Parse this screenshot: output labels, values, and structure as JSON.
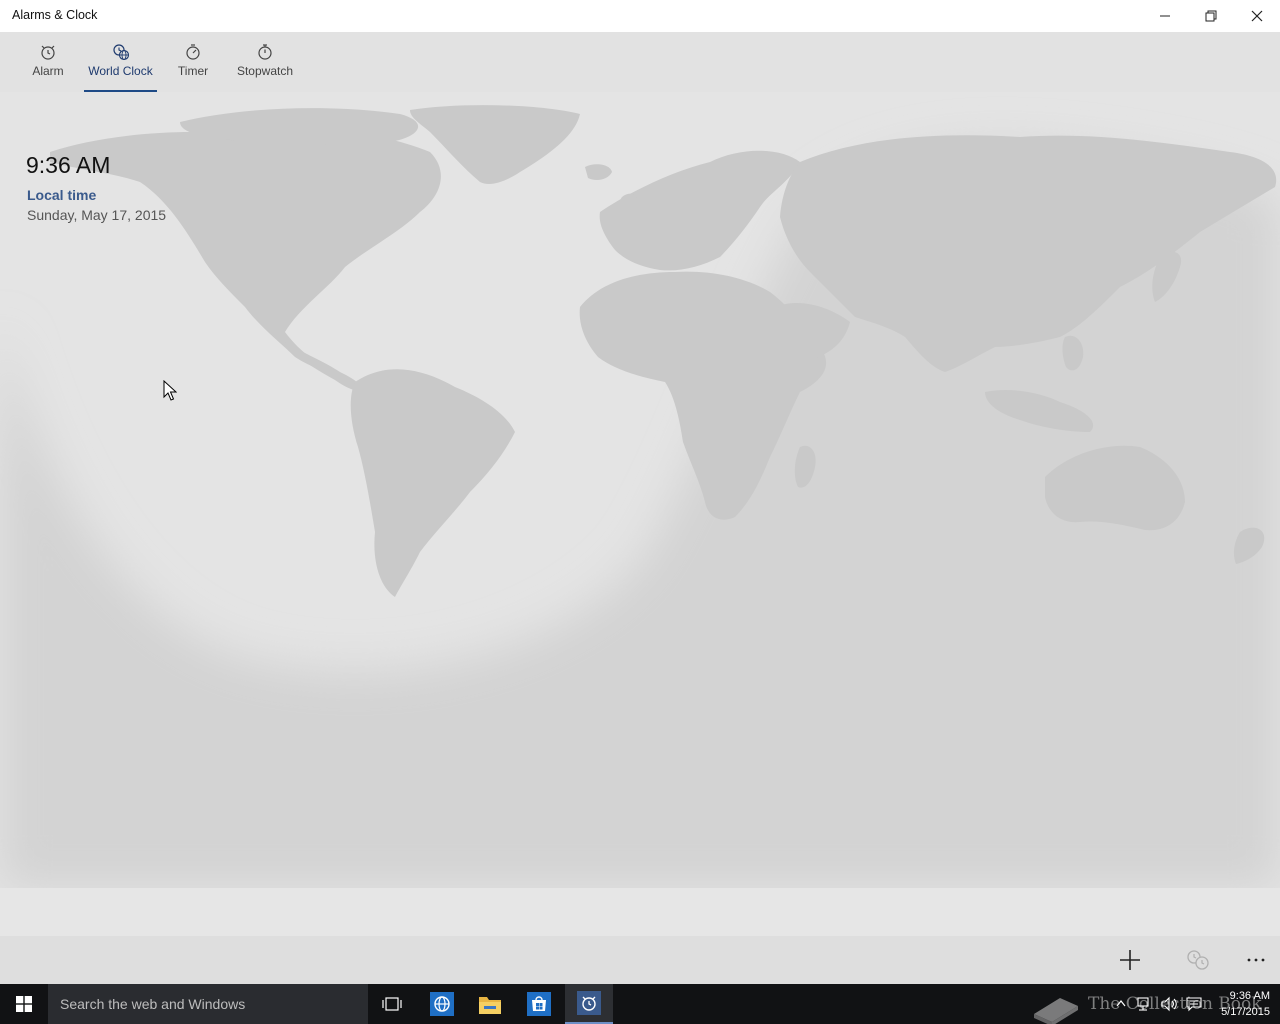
{
  "window": {
    "title": "Alarms & Clock",
    "controls": [
      "minimize-icon",
      "restore-icon",
      "close-icon"
    ]
  },
  "tabs": [
    {
      "label": "Alarm",
      "icon": "alarm-clock-icon",
      "selected": false
    },
    {
      "label": "World Clock",
      "icon": "world-clock-icon",
      "selected": true
    },
    {
      "label": "Timer",
      "icon": "timer-icon",
      "selected": false
    },
    {
      "label": "Stopwatch",
      "icon": "stopwatch-icon",
      "selected": false
    }
  ],
  "local_clock": {
    "time": "9:36 AM",
    "label": "Local time",
    "date": "Sunday, May 17, 2015"
  },
  "command_bar": {
    "buttons": [
      "add-icon",
      "compare-clocks-icon",
      "more-icon"
    ]
  },
  "taskbar": {
    "search_placeholder": "Search the web and Windows",
    "pinned": [
      "task-view-icon",
      "internet-explorer-icon",
      "file-explorer-icon",
      "store-icon",
      "alarms-app-icon"
    ],
    "watermark_text": "The Collection Book",
    "clock_time": "9:36 AM",
    "clock_date": "5/17/2015"
  },
  "colors": {
    "accent": "#1e4a86",
    "local_time_label": "#3a5a8c",
    "map_land": "#c9c9c9",
    "map_water": "#e4e4e4",
    "night_shade": "#c8c8c8",
    "taskbar": "#111214"
  }
}
